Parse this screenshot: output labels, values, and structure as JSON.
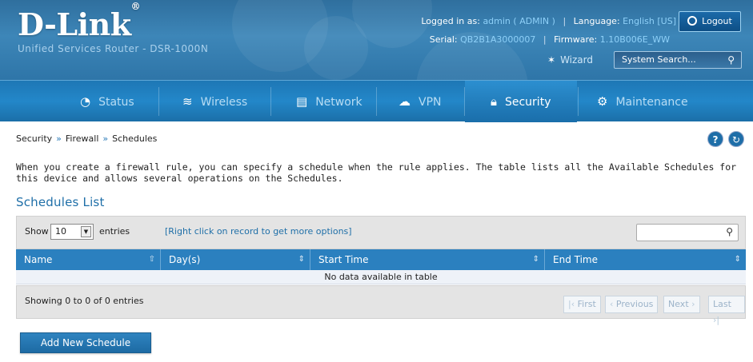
{
  "header": {
    "logo": "D-Link",
    "logo_mark": "®",
    "subtitle": "Unified Services Router - DSR-1000N",
    "logged_in_label": "Logged in as:",
    "logged_in_value": "admin ( ADMIN )",
    "language_label": "Language:",
    "language_value": "English [US]",
    "serial_label": "Serial:",
    "serial_value": "QB2B1A3000007",
    "firmware_label": "Firmware:",
    "firmware_value": "1.10B006E_WW",
    "logout_label": "Logout",
    "wizard_label": "Wizard",
    "search_placeholder": "System Search..."
  },
  "nav": {
    "items": [
      {
        "label": "Status",
        "icon": "gauge-icon"
      },
      {
        "label": "Wireless",
        "icon": "wifi-icon"
      },
      {
        "label": "Network",
        "icon": "monitor-icon"
      },
      {
        "label": "VPN",
        "icon": "cloud-lock-icon"
      },
      {
        "label": "Security",
        "icon": "lock-icon",
        "active": true
      },
      {
        "label": "Maintenance",
        "icon": "gears-icon"
      }
    ]
  },
  "breadcrumb": {
    "items": [
      "Security",
      "Firewall",
      "Schedules"
    ],
    "separator": "»"
  },
  "description": "When you create a firewall rule, you can specify a schedule when the rule applies. The table lists all the Available Schedules for this device and allows several operations on the Schedules.",
  "list_title": "Schedules List",
  "table": {
    "show_label": "Show",
    "entries_value": "10",
    "entries_label": "entries",
    "hint": "[Right click on record to get more options]",
    "columns": [
      "Name",
      "Day(s)",
      "Start Time",
      "End Time"
    ],
    "empty_message": "No data available in table",
    "showing_text": "Showing 0 to 0 of 0 entries",
    "pagination": {
      "first": "First",
      "previous": "Previous",
      "next": "Next",
      "last": "Last"
    }
  },
  "add_button": "Add New Schedule",
  "colors": {
    "accent": "#2b80bf",
    "header": "#2f6f9e",
    "title": "#1f6fa8"
  }
}
